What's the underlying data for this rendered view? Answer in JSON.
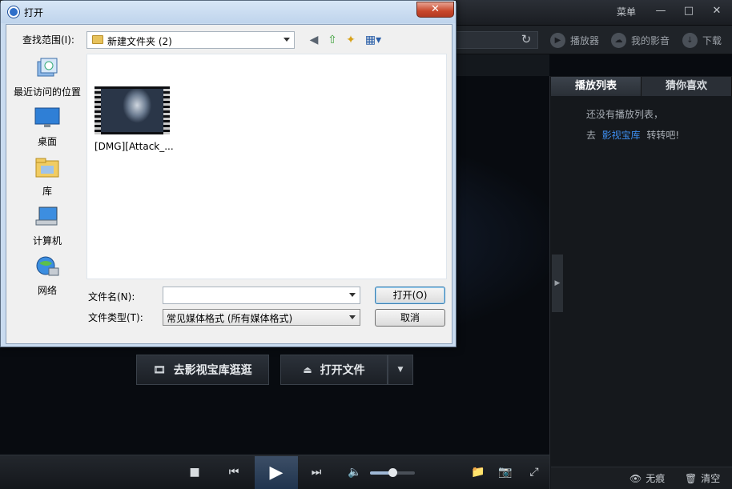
{
  "player": {
    "menu_label": "菜单",
    "nav": {
      "player_label": "播放器",
      "my_video_label": "我的影音",
      "download_label": "下载"
    },
    "sidebar": {
      "tab_playlist": "播放列表",
      "tab_recommend": "猜你喜欢",
      "empty_line1": "还没有播放列表，",
      "empty_go": "去",
      "empty_link": "影视宝库",
      "empty_after": "转转吧!",
      "no_trace_label": "无痕",
      "clear_label": "清空"
    },
    "center": {
      "library_button": "去影视宝库逛逛",
      "open_file_button": "打开文件"
    },
    "volume_level": 0.5
  },
  "dialog": {
    "title": "打开",
    "look_in_label": "查找范围(I):",
    "current_folder": "新建文件夹 (2)",
    "places": [
      {
        "label": "最近访问的位置",
        "icon": "recent-places-icon"
      },
      {
        "label": "桌面",
        "icon": "desktop-icon"
      },
      {
        "label": "库",
        "icon": "libraries-icon"
      },
      {
        "label": "计算机",
        "icon": "computer-icon"
      },
      {
        "label": "网络",
        "icon": "network-icon"
      }
    ],
    "files": [
      {
        "name": "[DMG][Attack_..."
      }
    ],
    "filename_label": "文件名(N):",
    "filename_value": "",
    "filetype_label": "文件类型(T):",
    "filetype_value": "常见媒体格式 (所有媒体格式)",
    "open_button": "打开(O)",
    "cancel_button": "取消"
  }
}
